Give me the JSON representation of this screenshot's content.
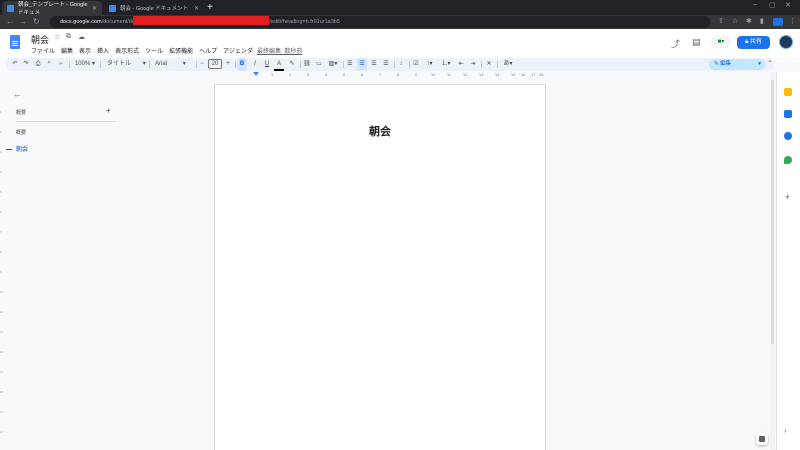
{
  "browser": {
    "tabs": [
      {
        "title": "朝会_テンプレート - Google ドキュメ",
        "active": true
      },
      {
        "title": "朝会 - Google ドキュメント",
        "active": false
      }
    ],
    "new_tab": "+",
    "window_controls": [
      "–",
      "▢",
      "✕"
    ],
    "url_host": "docs.google.com",
    "url_path": "/document/d/",
    "url_suffix": "/edit#heading=h.fr91ur1a3b5",
    "nav_icons": [
      "back-arrow-icon",
      "forward-arrow-icon",
      "reload-icon"
    ]
  },
  "docs": {
    "title": "朝会",
    "menu": [
      "ファイル",
      "編集",
      "表示",
      "挿入",
      "表示形式",
      "ツール",
      "拡張機能",
      "ヘルプ",
      "アジェンダ"
    ],
    "last_edit": "最終編集: 数秒前",
    "share_label": "共有",
    "meet_label": "▾"
  },
  "toolbar": {
    "zoom": "100%",
    "style": "タイトル",
    "font": "Arial",
    "font_size": "20",
    "bold": "B",
    "italic": "I",
    "underline": "U",
    "text_color": "A",
    "editing_mode": "✎ 編集"
  },
  "ruler": {
    "ticks": [
      "1",
      "2",
      "3",
      "4",
      "5",
      "6",
      "7",
      "8",
      "9",
      "10",
      "11",
      "12",
      "13",
      "14",
      "15",
      "16",
      "17",
      "18"
    ]
  },
  "vertical_ruler": {
    "ticks": [
      "1",
      "2",
      "3",
      "4",
      "5",
      "6",
      "7",
      "8",
      "9",
      "10",
      "11",
      "12",
      "13",
      "14",
      "15",
      "16",
      "17"
    ]
  },
  "outline": {
    "back": "←",
    "summary_label": "概要",
    "add": "+",
    "heading_label": "概要",
    "items": [
      "朝会"
    ]
  },
  "page": {
    "heading": "朝会"
  },
  "sidepanel": {
    "icons": [
      "keep-icon",
      "tasks-icon",
      "contacts-icon",
      "maps-icon"
    ],
    "icon_colors": [
      "#fbbc04",
      "#1a73e8",
      "#1a73e8",
      "#34a853"
    ],
    "plus": "+",
    "expand": "›"
  }
}
